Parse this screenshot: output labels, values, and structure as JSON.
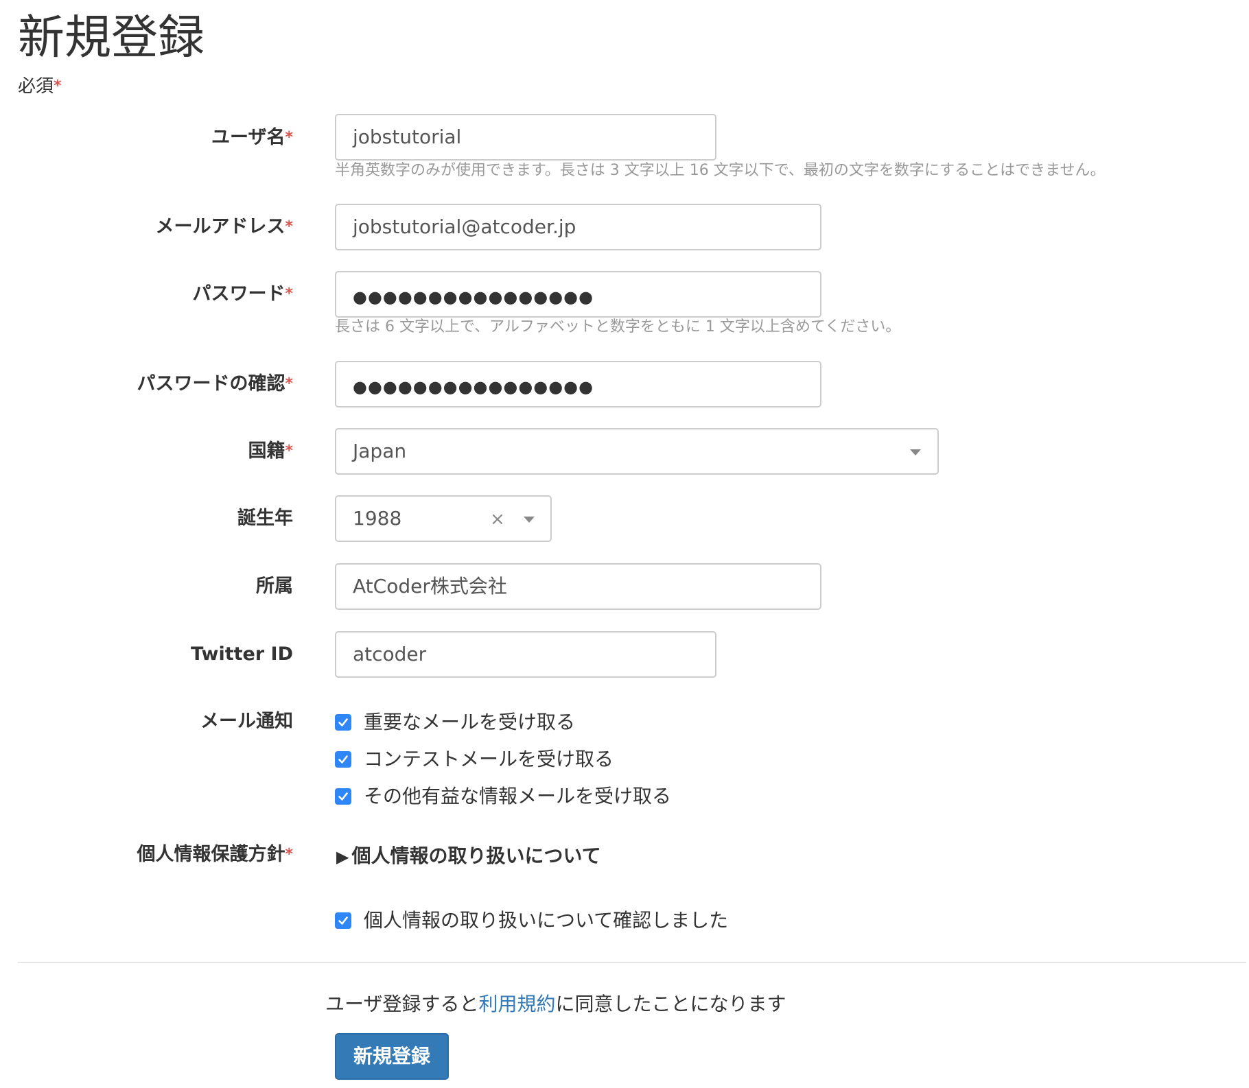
{
  "page": {
    "title": "新規登録",
    "required_note": "必須",
    "required_mark": "*"
  },
  "fields": {
    "username": {
      "label": "ユーザ名",
      "value": "jobstutorial",
      "help": "半角英数字のみが使用できます。長さは 3 文字以上 16 文字以下で、最初の文字を数字にすることはできません。"
    },
    "email": {
      "label": "メールアドレス",
      "value": "jobstutorial@atcoder.jp"
    },
    "password": {
      "label": "パスワード",
      "value": "●●●●●●●●●●●●●●●●",
      "help": "長さは 6 文字以上で、アルファベットと数字をともに 1 文字以上含めてください。"
    },
    "password_confirm": {
      "label": "パスワードの確認",
      "value": "●●●●●●●●●●●●●●●●"
    },
    "country": {
      "label": "国籍",
      "value": "Japan"
    },
    "birth_year": {
      "label": "誕生年",
      "value": "1988",
      "clear": "×"
    },
    "affiliation": {
      "label": "所属",
      "value": "AtCoder株式会社"
    },
    "twitter": {
      "label": "Twitter ID",
      "value": "atcoder"
    },
    "mail_notify": {
      "label": "メール通知",
      "options": [
        {
          "label": "重要なメールを受け取る",
          "checked": true
        },
        {
          "label": "コンテストメールを受け取る",
          "checked": true
        },
        {
          "label": "その他有益な情報メールを受け取る",
          "checked": true
        }
      ]
    },
    "privacy": {
      "label": "個人情報保護方針",
      "toggle_marker": "▶",
      "toggle_label": "個人情報の取り扱いについて",
      "confirm_label": "個人情報の取り扱いについて確認しました",
      "confirm_checked": true
    }
  },
  "footer": {
    "agree_prefix": "ユーザ登録すると",
    "terms_link": "利用規約",
    "agree_suffix": "に同意したことになります",
    "submit_label": "新規登録"
  },
  "colors": {
    "accent": "#337ab7",
    "checkbox": "#2f86f6",
    "required": "#d9534f"
  }
}
